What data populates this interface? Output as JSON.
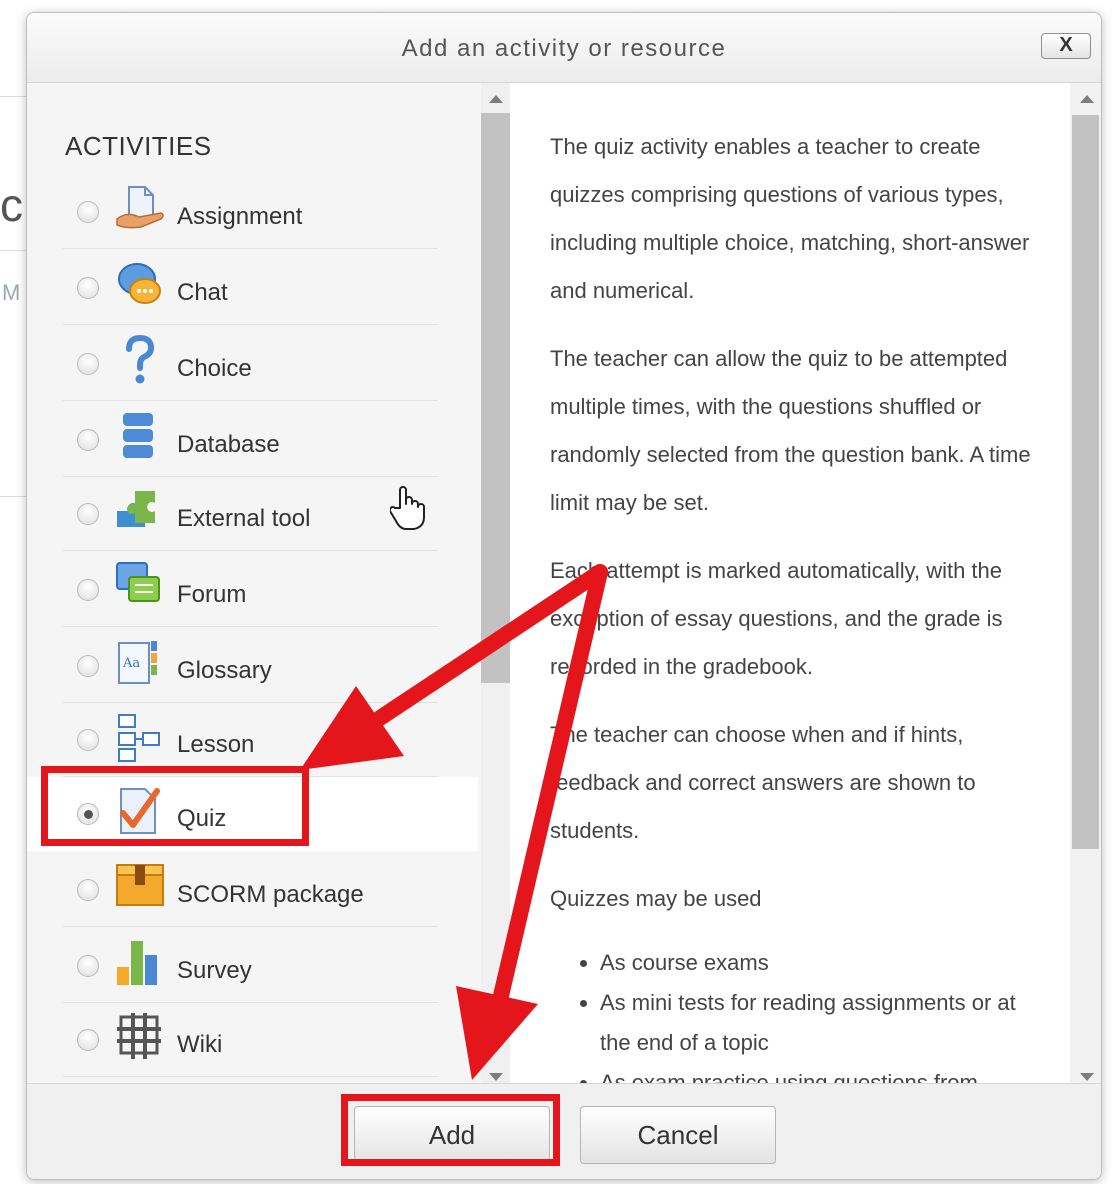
{
  "dialog": {
    "title": "Add an activity or resource",
    "close_label": "X"
  },
  "options": {
    "heading": "ACTIVITIES",
    "items": [
      {
        "label": "Assignment",
        "icon": "assignment-icon",
        "selected": false
      },
      {
        "label": "Chat",
        "icon": "chat-icon",
        "selected": false
      },
      {
        "label": "Choice",
        "icon": "choice-icon",
        "selected": false
      },
      {
        "label": "Database",
        "icon": "database-icon",
        "selected": false
      },
      {
        "label": "External tool",
        "icon": "external-tool-icon",
        "selected": false
      },
      {
        "label": "Forum",
        "icon": "forum-icon",
        "selected": false
      },
      {
        "label": "Glossary",
        "icon": "glossary-icon",
        "selected": false
      },
      {
        "label": "Lesson",
        "icon": "lesson-icon",
        "selected": false
      },
      {
        "label": "Quiz",
        "icon": "quiz-icon",
        "selected": true
      },
      {
        "label": "SCORM package",
        "icon": "scorm-package-icon",
        "selected": false
      },
      {
        "label": "Survey",
        "icon": "survey-icon",
        "selected": false
      },
      {
        "label": "Wiki",
        "icon": "wiki-icon",
        "selected": false
      }
    ]
  },
  "description": {
    "paragraphs": [
      "The quiz activity enables a teacher to create quizzes comprising questions of various types, including multiple choice, matching, short-answer and numerical.",
      "The teacher can allow the quiz to be attempted multiple times, with the questions shuffled or randomly selected from the question bank. A time limit may be set.",
      "Each attempt is marked automatically, with the exception of essay questions, and the grade is recorded in the gradebook.",
      "The teacher can choose when and if hints, feedback and correct answers are shown to students.",
      "Quizzes may be used"
    ],
    "list": [
      "As course exams",
      "As mini tests for reading assignments or at the end of a topic",
      "As exam practice using questions from"
    ]
  },
  "footer": {
    "add_label": "Add",
    "cancel_label": "Cancel"
  },
  "colors": {
    "annotation": "#e5161b",
    "header_text": "#555555",
    "options_bg": "#f5f5f5"
  }
}
